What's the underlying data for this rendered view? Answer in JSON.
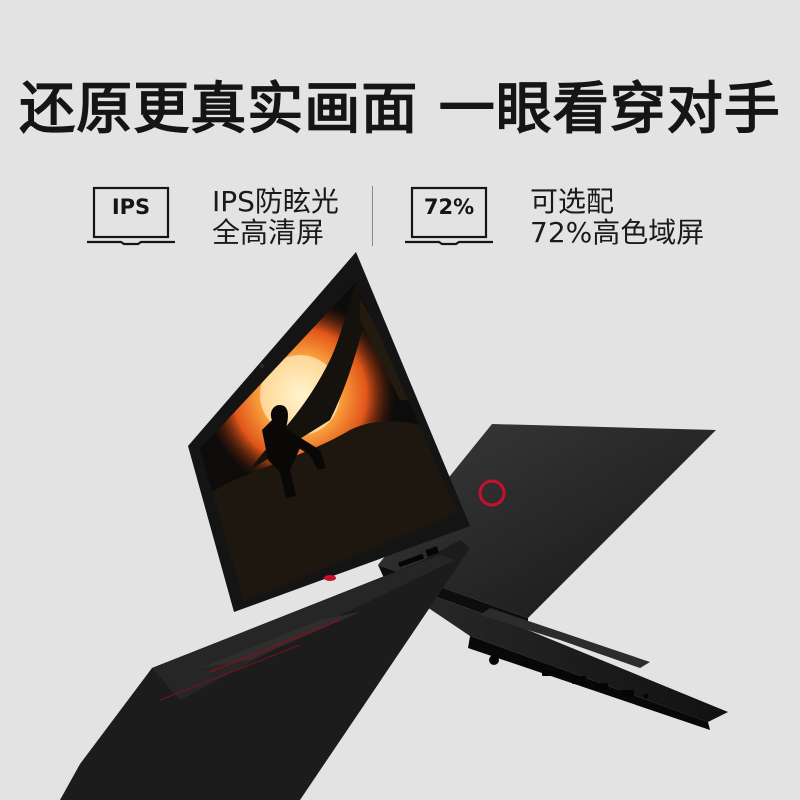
{
  "headline": "还原更真实画面 一眼看穿对手",
  "features": [
    {
      "badge": "IPS",
      "line1": "IPS防眩光",
      "line2": "全高清屏"
    },
    {
      "badge": "72%",
      "line1": "可选配",
      "line2": "72%高色域屏"
    }
  ],
  "icons": {
    "badge_outline": "laptop-outline-icon",
    "logo": "dell-logo-icon"
  },
  "colors": {
    "background": "#e3e3e3",
    "accent_red": "#c8102e",
    "laptop_body": "#1c1c1c"
  }
}
